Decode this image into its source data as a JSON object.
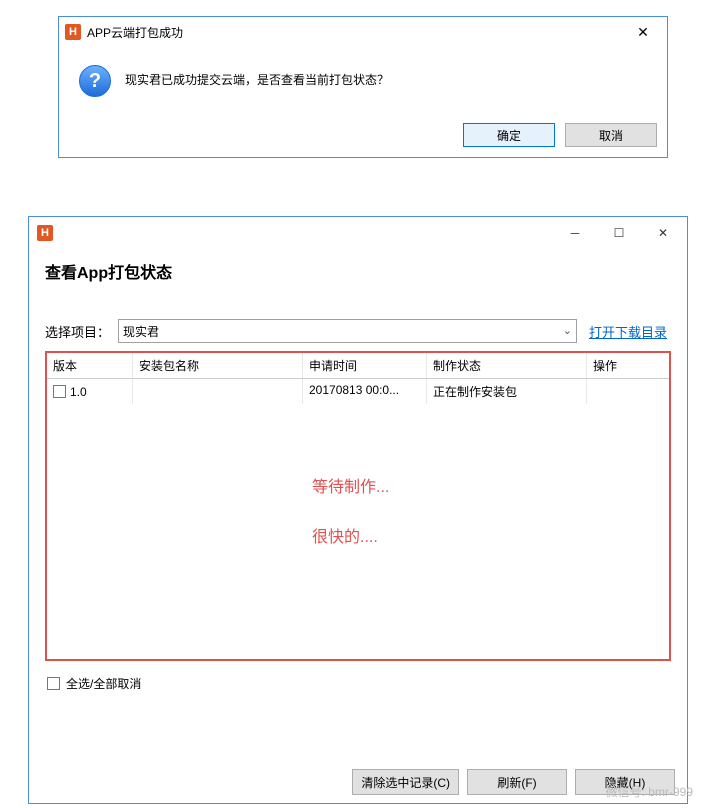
{
  "dialog1": {
    "title": "APP云端打包成功",
    "message": "现实君已成功提交云端，是否查看当前打包状态？",
    "ok": "确定",
    "cancel": "取消"
  },
  "dialog2": {
    "heading": "查看App打包状态",
    "project_label": "选择项目：",
    "project_value": "现实君",
    "download_link": "打开下载目录",
    "columns": {
      "c1": "版本",
      "c2": "安装包名称",
      "c3": "申请时间",
      "c4": "制作状态",
      "c5": "操作"
    },
    "row": {
      "version": "1.0",
      "pkg": "",
      "time": "20170813 00:0...",
      "status": "正在制作安装包",
      "op": ""
    },
    "note1": "等待制作...",
    "note2": "很快的....",
    "select_all": "全选/全部取消",
    "btn_clear": "清除选中记录(C)",
    "btn_refresh": "刷新(F)",
    "btn_hide": "隐藏(H)"
  },
  "watermark": "微信号: bmr-999"
}
